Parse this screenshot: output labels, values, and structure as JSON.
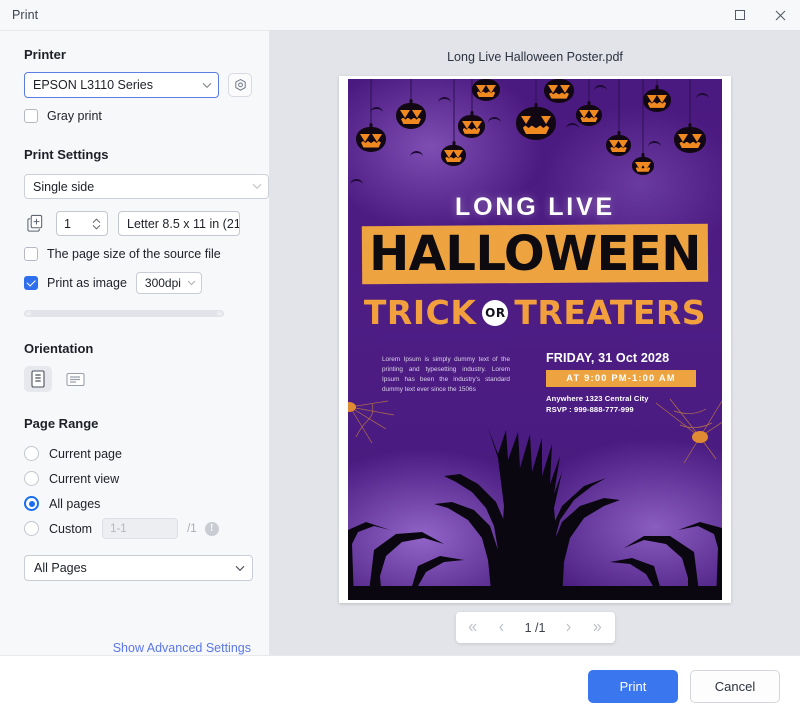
{
  "window": {
    "title": "Print",
    "maximize_icon": "maximize-icon",
    "close_icon": "close-icon"
  },
  "sidebar": {
    "printer": {
      "heading": "Printer",
      "selected": "EPSON L3110 Series",
      "settings_icon": "gear-icon",
      "gray_print": {
        "label": "Gray print",
        "checked": false
      }
    },
    "print_settings": {
      "heading": "Print Settings",
      "duplex": "Single side",
      "copies": "1",
      "copies_icon": "copies-icon",
      "paper_size": "Letter 8.5 x 11 in (21",
      "source_page_size": {
        "label": "The page size of the source file",
        "checked": false
      },
      "print_as_image": {
        "label": "Print as image",
        "checked": true
      },
      "dpi": "300dpi"
    },
    "orientation": {
      "heading": "Orientation",
      "portrait_icon": "portrait-icon",
      "landscape_icon": "landscape-icon",
      "selected": "portrait"
    },
    "page_range": {
      "heading": "Page Range",
      "options": [
        {
          "label": "Current page",
          "selected": false
        },
        {
          "label": "Current view",
          "selected": false
        },
        {
          "label": "All pages",
          "selected": true
        },
        {
          "label": "Custom",
          "selected": false
        }
      ],
      "custom_placeholder": "1-1",
      "total_pages": "/1",
      "info_icon": "info-icon",
      "subset": "All Pages"
    },
    "advanced_link": "Show Advanced Settings"
  },
  "preview": {
    "document_title": "Long Live Halloween Poster.pdf",
    "pager": {
      "first_icon": "double-chevron-left-icon",
      "prev_icon": "chevron-left-icon",
      "current": "1 /1",
      "next_icon": "chevron-right-icon",
      "last_icon": "double-chevron-right-icon"
    },
    "poster": {
      "headline_top": "LONG LIVE",
      "headline_main": "HALLOWEEN",
      "sub_left": "TRICK",
      "sub_badge": "OR",
      "sub_right": "TREATERS",
      "body_text": "Lorem Ipsum is simply dummy text of the printing and typesetting industry. Lorem Ipsum has been the industry's standard dummy text ever since the 1506s",
      "date": "FRIDAY, 31 Oct 2028",
      "time": "AT 9:00 PM-1:00 AM",
      "address": "Anywhere 1323 Central City",
      "rsvp": "RSVP : 999-888-777-999",
      "colors": {
        "background": "#4b1a80",
        "accent": "#eda33f",
        "text": "#ffffff"
      }
    }
  },
  "footer": {
    "print_label": "Print",
    "cancel_label": "Cancel"
  },
  "theme": {
    "accent": "#3a76ee",
    "link": "#5b78e8",
    "sidebar_bg": "#f7f8fa",
    "preview_bg": "#e2e4e9"
  }
}
